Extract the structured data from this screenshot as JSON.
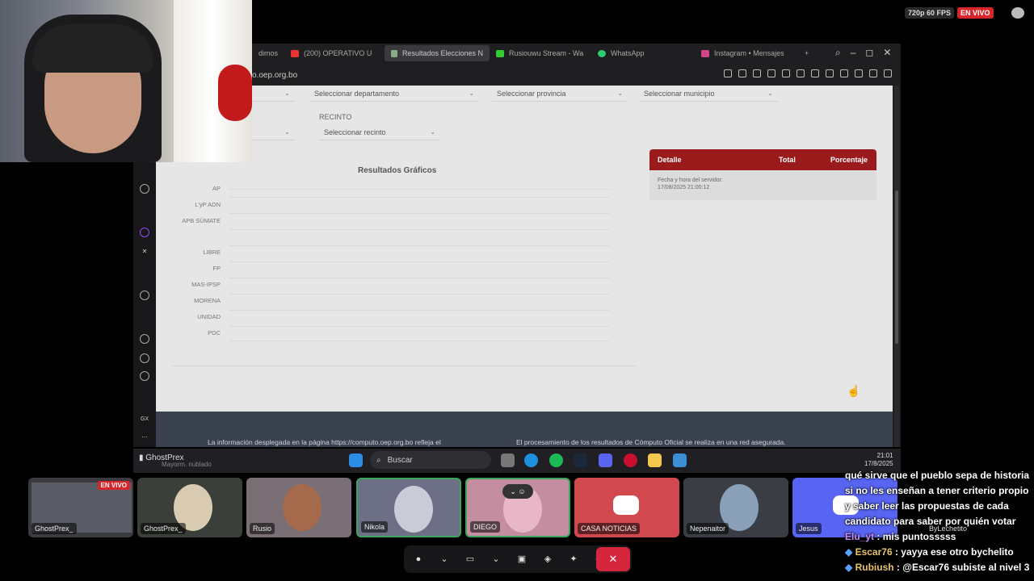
{
  "stream_status": {
    "quality": "720p 60 FPS",
    "live": "EN VIVO"
  },
  "browser": {
    "tabs": [
      {
        "label": "dimos",
        "color": "#555"
      },
      {
        "label": "(200) OPERATIVO U",
        "color": "#e33"
      },
      {
        "label": "Resultados Elecciones N",
        "color": "#8a8",
        "active": true
      },
      {
        "label": "Rusiouwu Stream - Wa",
        "color": "#3c3"
      },
      {
        "label": "WhatsApp",
        "color": "#2ecc71"
      },
      {
        "label": "Instagram • Mensajes",
        "color": "#d0468a"
      }
    ],
    "address": "o.oep.org.bo"
  },
  "page": {
    "selects": {
      "departamento": "Seleccionar departamento",
      "provincia": "Seleccionar provincia",
      "municipio": "Seleccionar municipio",
      "recinto": "Seleccionar recinto"
    },
    "recinto_label": "RECINTO",
    "graficos_title": "Resultados Gráficos",
    "parties": [
      "AP",
      "L'yP ADN",
      "APB SÚMATE",
      "",
      "LIBRE",
      "FP",
      "MAS-IPSP",
      "MORENA",
      "UNIDAD",
      "PDC"
    ],
    "detail": {
      "col1": "Detalle",
      "col2": "Total",
      "col3": "Porcentaje",
      "server_label": "Fecha y hora del servidor:",
      "server_time": "17/08/2025 21:00:12"
    },
    "footer_left": "La información desplegada en la página https://computo.oep.org.bo refleja el",
    "footer_right": "El procesamiento de los resultados de Cómputo Oficial se realiza en una red asegurada."
  },
  "taskbar": {
    "search": "Buscar",
    "time": "21:01",
    "date": "17/8/2025",
    "overlay_user": "GhostPrex",
    "weather_partial": "Mayorm. nublado"
  },
  "discord": {
    "tiles": [
      {
        "name": "GhostPrex_",
        "live": "EN VIVO",
        "bg": "#3b3b3f"
      },
      {
        "name": "GhostPrex_",
        "bg": "#3a3f3a"
      },
      {
        "name": "Rusio",
        "bg": "#7a6f75"
      },
      {
        "name": "Nikola",
        "bg": "#6c6f86"
      },
      {
        "name": "DIEGO",
        "bg": "#c48ea0"
      },
      {
        "name": "CASA NOTICIAS",
        "bg": "#d2484f"
      },
      {
        "name": "Nepenaitor",
        "bg": "#3a3d44"
      },
      {
        "name": "Jesus",
        "bg": "#5865f2"
      }
    ],
    "extra_name": "ByLechetito"
  },
  "chat": {
    "lines": [
      {
        "user": "",
        "text": "qué sirve que el pueblo sepa de historia si no les enseñan a tener criterio propio y saber leer las propuestas de cada candidato para saber por quién votar"
      },
      {
        "user": "Elu_yt",
        "text": "mis puntosssss"
      },
      {
        "user": "Escar76",
        "text": "yayya ese otro bychelito"
      },
      {
        "user": "Rubiush",
        "text": "@Escar76 subiste al nivel 3"
      }
    ]
  }
}
